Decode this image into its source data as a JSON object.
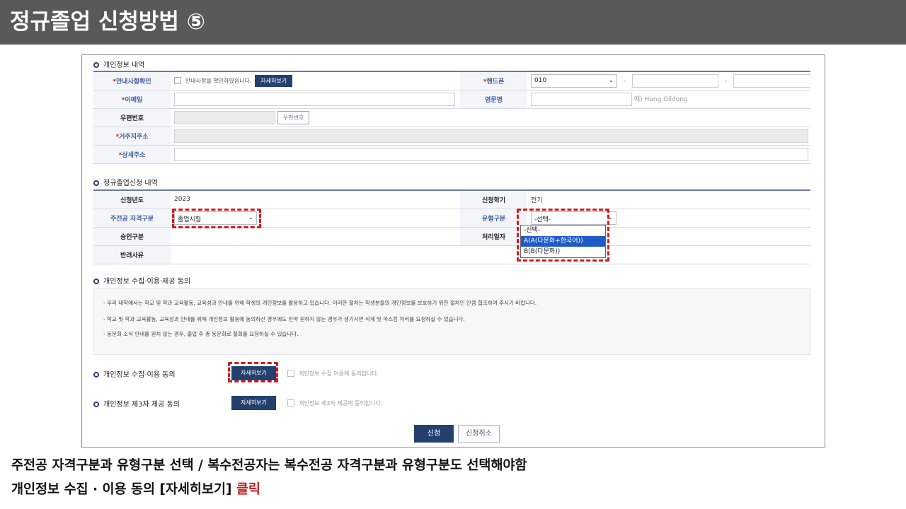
{
  "header": {
    "title": "정규졸업 신청방법 ⑤"
  },
  "personal": {
    "section_title": "개인정보 내역",
    "notice_label": "안내사항확인",
    "notice_text": "안내사항을 확인하였습니다.",
    "detail_btn": "자세히보기",
    "phone_label": "핸드폰",
    "phone_prefix": "010",
    "dash": "-",
    "email_label": "이메일",
    "eng_name_label": "영문명",
    "eng_name_hint": "예) Hong Gildong",
    "zip_label": "우편번호",
    "zip_btn": "우편번호",
    "address_label": "거주지주소",
    "detail_address_label": "상세주소",
    "star": "*"
  },
  "application": {
    "section_title": "정규졸업신청 내역",
    "year_label": "신청년도",
    "year_value": "2023",
    "semester_label": "신청학기",
    "semester_value": "전기",
    "major_qual_label": "주전공 자격구분",
    "major_qual_value": "졸업시험",
    "type_label": "유형구분",
    "type_value": "-선택-",
    "approval_label": "승인구분",
    "process_date_label": "처리일자",
    "reject_label": "반려사유",
    "type_options": [
      "-선택-",
      "A(A(다문화+한국어))",
      "B(B(다문화))"
    ],
    "type_selected_index": 1
  },
  "consent": {
    "section_title": "개인정보 수집·이용·제공 동의",
    "lines": [
      "- 우리 대학에서는 학교 및 학과 교육활동, 교육성과 안내를 위해 학생의 개인정보를 활용하고 있습니다. 이러한 절차는 학생분들의 개인정보를 보호하기 위한 절차인 만큼 협조하여 주시기 바랍니다.",
      "- 학교 및 학과 교육활동, 교육성과 안내를 위해 개인정보 활용에 동의하신 경우에도 만약 원하지 않는 경우가 생기시면 삭제 및 마스킹 처리를 요청하실 수 있습니다.",
      "- 동문회 소식 안내를 원치 않는 경우, 졸업 후 총 동문회로 철회를 요청하실 수 있습니다."
    ],
    "collect_label": "개인정보 수집·이용 동의",
    "collect_btn": "자세히보기",
    "collect_check": "개인정보 수집 이용에 동의합니다.",
    "third_label": "개인정보 제3자 제공 동의",
    "third_btn": "자세히보기",
    "third_check": "개인정보 제3자 제공에 동의합니다."
  },
  "actions": {
    "submit": "신청",
    "cancel": "신청취소"
  },
  "caption": {
    "line1": "주전공 자격구분과 유형구분 선택 / 복수전공자는 복수전공 자격구분과 유형구분도 선택해야함",
    "line2_prefix": "개인정보 수집 · 이용 동의 [자세히보기] ",
    "line2_red": "클릭"
  },
  "colors": {
    "header_bg": "#595959",
    "navy": "#24406f",
    "highlight": "#d11b1b",
    "select_highlight": "#1f5bc6"
  }
}
